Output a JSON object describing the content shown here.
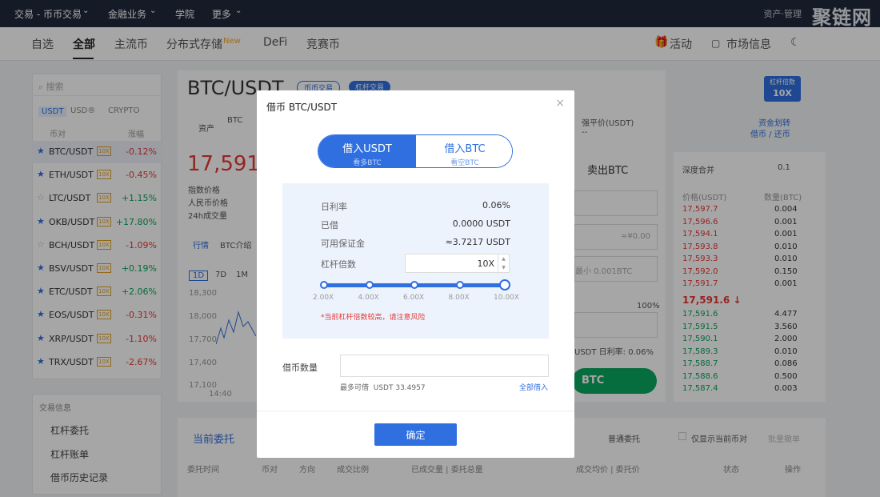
{
  "topnav": {
    "items": [
      "交易 - 币币交易",
      "金融业务",
      "学院",
      "更多"
    ],
    "right_text": "资产·管理",
    "watermark": "聚链网"
  },
  "subnav": {
    "tabs": [
      "自选",
      "全部",
      "主流币",
      "分布式存储",
      "DeFi",
      "竞赛币"
    ],
    "new_badge": "New",
    "activity": "活动",
    "market_info": "市场信息"
  },
  "left": {
    "search_placeholder": "搜索",
    "market_tabs": [
      "USDT",
      "USD®",
      "CRYPTO"
    ],
    "col_pair": "币对",
    "col_change": "涨幅",
    "leverage_tag": "10X",
    "pairs": [
      {
        "sym": "BTC/USDT",
        "chg": "-0.12%",
        "fav": true
      },
      {
        "sym": "ETH/USDT",
        "chg": "-0.45%",
        "fav": true
      },
      {
        "sym": "LTC/USDT",
        "chg": "+1.15%",
        "fav": false
      },
      {
        "sym": "OKB/USDT",
        "chg": "+17.80%",
        "fav": true
      },
      {
        "sym": "BCH/USDT",
        "chg": "-1.09%",
        "fav": false
      },
      {
        "sym": "BSV/USDT",
        "chg": "+0.19%",
        "fav": true
      },
      {
        "sym": "ETC/USDT",
        "chg": "+2.06%",
        "fav": true
      },
      {
        "sym": "EOS/USDT",
        "chg": "-0.31%",
        "fav": true
      },
      {
        "sym": "XRP/USDT",
        "chg": "-1.10%",
        "fav": true
      },
      {
        "sym": "TRX/USDT",
        "chg": "-2.67%",
        "fav": true
      }
    ],
    "tools_title": "交易信息",
    "tools": [
      "杠杆委托",
      "杠杆账单",
      "借币历史记录"
    ]
  },
  "main": {
    "pair": "BTC/USDT",
    "tab_spot": "币币交易",
    "tab_margin": "杠杆交易",
    "badge_label": "杠杆倍数",
    "badge_value": "10X",
    "asset_label": "资产",
    "asset_sub": "BTC",
    "force_price": "强平价(USDT)",
    "force_val": "--",
    "transfer": "资金划转",
    "borrow_repay": "借币 / 还币",
    "price": "17,591.6",
    "index_price": "指数价格",
    "cny_price": "人民币价格",
    "vol24": "24h成交量",
    "tab_quote": "行情",
    "tab_intro": "BTC介绍",
    "periods": [
      "1D",
      "7D",
      "1M"
    ],
    "y_ticks": [
      "18,300",
      "18,000",
      "17,700",
      "17,400",
      "17,100"
    ],
    "x_tick": "14:40",
    "sell_btc": "卖出BTC",
    "sell_btn": "BTC",
    "input_hint1": "≈¥0.00",
    "input_hint2": "最小 0.001BTC",
    "pct100": "100%",
    "daily_rate": "USDT 日利率: 0.06%",
    "orders_tab": "当前委托",
    "order_type": "普通委托",
    "only_current": "仅显示当前币对",
    "cancel_all": "批量撤单",
    "order_cols": [
      "委托时间",
      "币对",
      "方向",
      "成交比例",
      "已成交量 | 委托总量",
      "成交均价 | 委托价",
      "状态",
      "操作"
    ]
  },
  "orderbook": {
    "depth": "深度合并",
    "depth_val": "0.1",
    "col_price": "价格(USDT)",
    "col_qty": "数量(BTC)",
    "asks": [
      [
        "17,597.7",
        "0.004"
      ],
      [
        "17,596.6",
        "0.001"
      ],
      [
        "17,594.1",
        "0.001"
      ],
      [
        "17,593.8",
        "0.010"
      ],
      [
        "17,593.3",
        "0.010"
      ],
      [
        "17,592.0",
        "0.150"
      ],
      [
        "17,591.7",
        "0.001"
      ]
    ],
    "last": "17,591.6 ↓",
    "bids": [
      [
        "17,591.6",
        "4.477"
      ],
      [
        "17,591.5",
        "3.560"
      ],
      [
        "17,590.1",
        "2.000"
      ],
      [
        "17,589.3",
        "0.010"
      ],
      [
        "17,588.7",
        "0.086"
      ],
      [
        "17,588.6",
        "0.500"
      ],
      [
        "17,587.4",
        "0.003"
      ]
    ]
  },
  "modal": {
    "title": "借币 BTC/USDT",
    "close": "×",
    "seg1_title": "借入USDT",
    "seg1_sub": "看多BTC",
    "seg2_title": "借入BTC",
    "seg2_sub": "看空BTC",
    "daily_rate_label": "日利率",
    "daily_rate": "0.06%",
    "borrowed_label": "已借",
    "borrowed": "0.0000 USDT",
    "margin_label": "可用保证金",
    "margin": "≈3.7217 USDT",
    "leverage_label": "杠杆倍数",
    "leverage": "10X",
    "leverage_level": 1.0,
    "ticks": [
      "2.00X",
      "4.00X",
      "6.00X",
      "8.00X",
      "10.00X"
    ],
    "warning": "*当前杠杆倍数较高，请注意风险",
    "amount_label": "借币数量",
    "amount_value": "",
    "max_label": "最多可借",
    "max_value": "USDT 33.4957",
    "borrow_all": "全部借入",
    "confirm": "确定"
  }
}
